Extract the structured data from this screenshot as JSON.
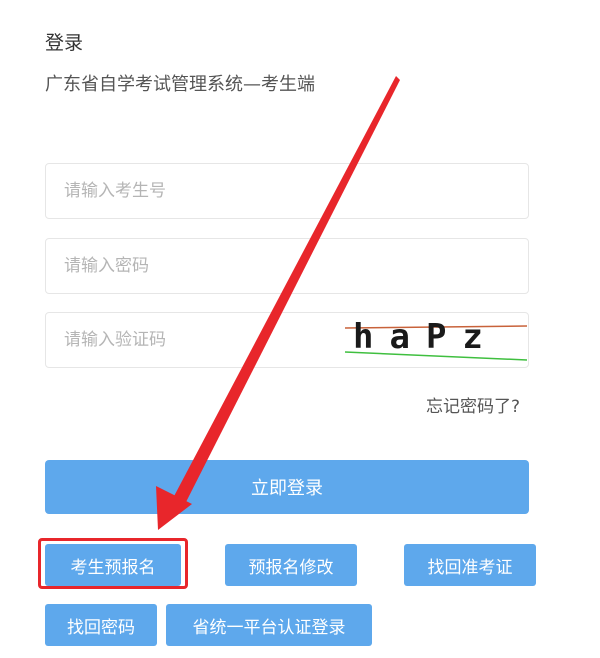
{
  "header": {
    "title": "登录",
    "subtitle": "广东省自学考试管理系统—考生端"
  },
  "form": {
    "candidate_id_placeholder": "请输入考生号",
    "password_placeholder": "请输入密码",
    "captcha_placeholder": "请输入验证码",
    "captcha_text": "haPz",
    "forgot_password": "忘记密码了?",
    "login_button": "立即登录"
  },
  "actions": {
    "pre_register": "考生预报名",
    "modify_pre_register": "预报名修改",
    "retrieve_admission_ticket": "找回准考证",
    "retrieve_password": "找回密码",
    "unified_login": "省统一平台认证登录"
  },
  "annotation": {
    "color": "#e8262b"
  },
  "colors": {
    "primary_button": "#5ea8ec"
  }
}
